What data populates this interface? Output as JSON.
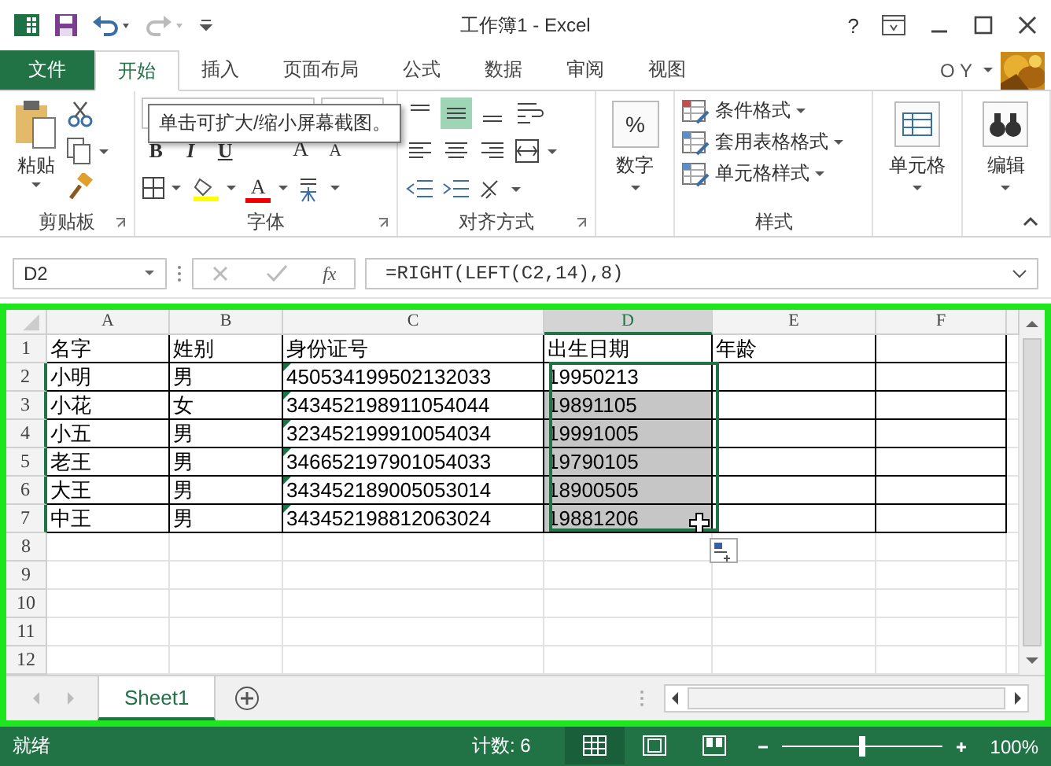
{
  "window": {
    "title": "工作簿1 - Excel",
    "help": "?"
  },
  "ribbon_tabs": [
    {
      "label": "文件",
      "kind": "file",
      "selected": false
    },
    {
      "label": "开始",
      "kind": "tab",
      "selected": true
    },
    {
      "label": "插入",
      "kind": "tab",
      "selected": false
    },
    {
      "label": "页面布局",
      "kind": "tab",
      "selected": false
    },
    {
      "label": "公式",
      "kind": "tab",
      "selected": false
    },
    {
      "label": "数据",
      "kind": "tab",
      "selected": false
    },
    {
      "label": "审阅",
      "kind": "tab",
      "selected": false
    },
    {
      "label": "视图",
      "kind": "tab",
      "selected": false
    }
  ],
  "account": {
    "name": "O Y"
  },
  "ribbon": {
    "clipboard": {
      "label": "剪贴板",
      "paste": "粘贴"
    },
    "font": {
      "label": "字体",
      "style_buttons": [
        "B",
        "I",
        "U"
      ],
      "size_buttons": [
        "A",
        "A"
      ],
      "color_button": "A"
    },
    "alignment": {
      "label": "对齐方式",
      "vertical_buttons": [
        {
          "selected": false
        },
        {
          "selected": true
        },
        {
          "selected": false
        }
      ]
    },
    "number": {
      "symbol": "%",
      "button": "数字"
    },
    "styles": {
      "label": "样式",
      "items": [
        "条件格式",
        "套用表格格式",
        "单元格样式"
      ]
    },
    "cells": {
      "button": "单元格"
    },
    "editing": {
      "button": "编辑"
    }
  },
  "tooltip": "单击可扩大/缩小屏幕截图。",
  "formula_bar": {
    "name_box": "D2",
    "function_label": "fx",
    "formula": "=RIGHT(LEFT(C2,14),8)"
  },
  "columns": [
    {
      "label": "A",
      "selected": false
    },
    {
      "label": "B",
      "selected": false
    },
    {
      "label": "C",
      "selected": false
    },
    {
      "label": "D",
      "selected": true
    },
    {
      "label": "E",
      "selected": false
    },
    {
      "label": "F",
      "selected": false
    }
  ],
  "rows": [
    {
      "header": "1",
      "selected": false,
      "flagged": false,
      "cells": [
        "名字",
        "姓别",
        "身份证号",
        "出生日期",
        "年龄"
      ]
    },
    {
      "header": "2",
      "selected": true,
      "flagged": true,
      "cells": [
        "小明",
        "男",
        "450534199502132033",
        "19950213"
      ]
    },
    {
      "header": "3",
      "selected": true,
      "flagged": true,
      "cells": [
        "小花",
        "女",
        "343452198911054044",
        "19891105"
      ]
    },
    {
      "header": "4",
      "selected": true,
      "flagged": true,
      "cells": [
        "小五",
        "男",
        "323452199910054034",
        "19991005"
      ]
    },
    {
      "header": "5",
      "selected": true,
      "flagged": true,
      "cells": [
        "老王",
        "男",
        "346652197901054033",
        "19790105"
      ]
    },
    {
      "header": "6",
      "selected": true,
      "flagged": true,
      "cells": [
        "大王",
        "男",
        "343452189005053014",
        "18900505"
      ]
    },
    {
      "header": "7",
      "selected": true,
      "flagged": true,
      "cells": [
        "中王",
        "男",
        "343452198812063024",
        "19881206"
      ]
    },
    {
      "header": "8",
      "selected": false,
      "flagged": false
    },
    {
      "header": "9",
      "selected": false,
      "flagged": false
    },
    {
      "header": "10",
      "selected": false,
      "flagged": false
    },
    {
      "header": "11",
      "selected": false,
      "flagged": false
    },
    {
      "header": "12",
      "selected": false,
      "flagged": false
    }
  ],
  "sheet_tabs": [
    {
      "label": "Sheet1",
      "selected": true
    }
  ],
  "status_bar": {
    "status": "就绪",
    "count": "计数: 6",
    "zoom": {
      "level": 0.5
    },
    "zoom_text": "100%"
  }
}
